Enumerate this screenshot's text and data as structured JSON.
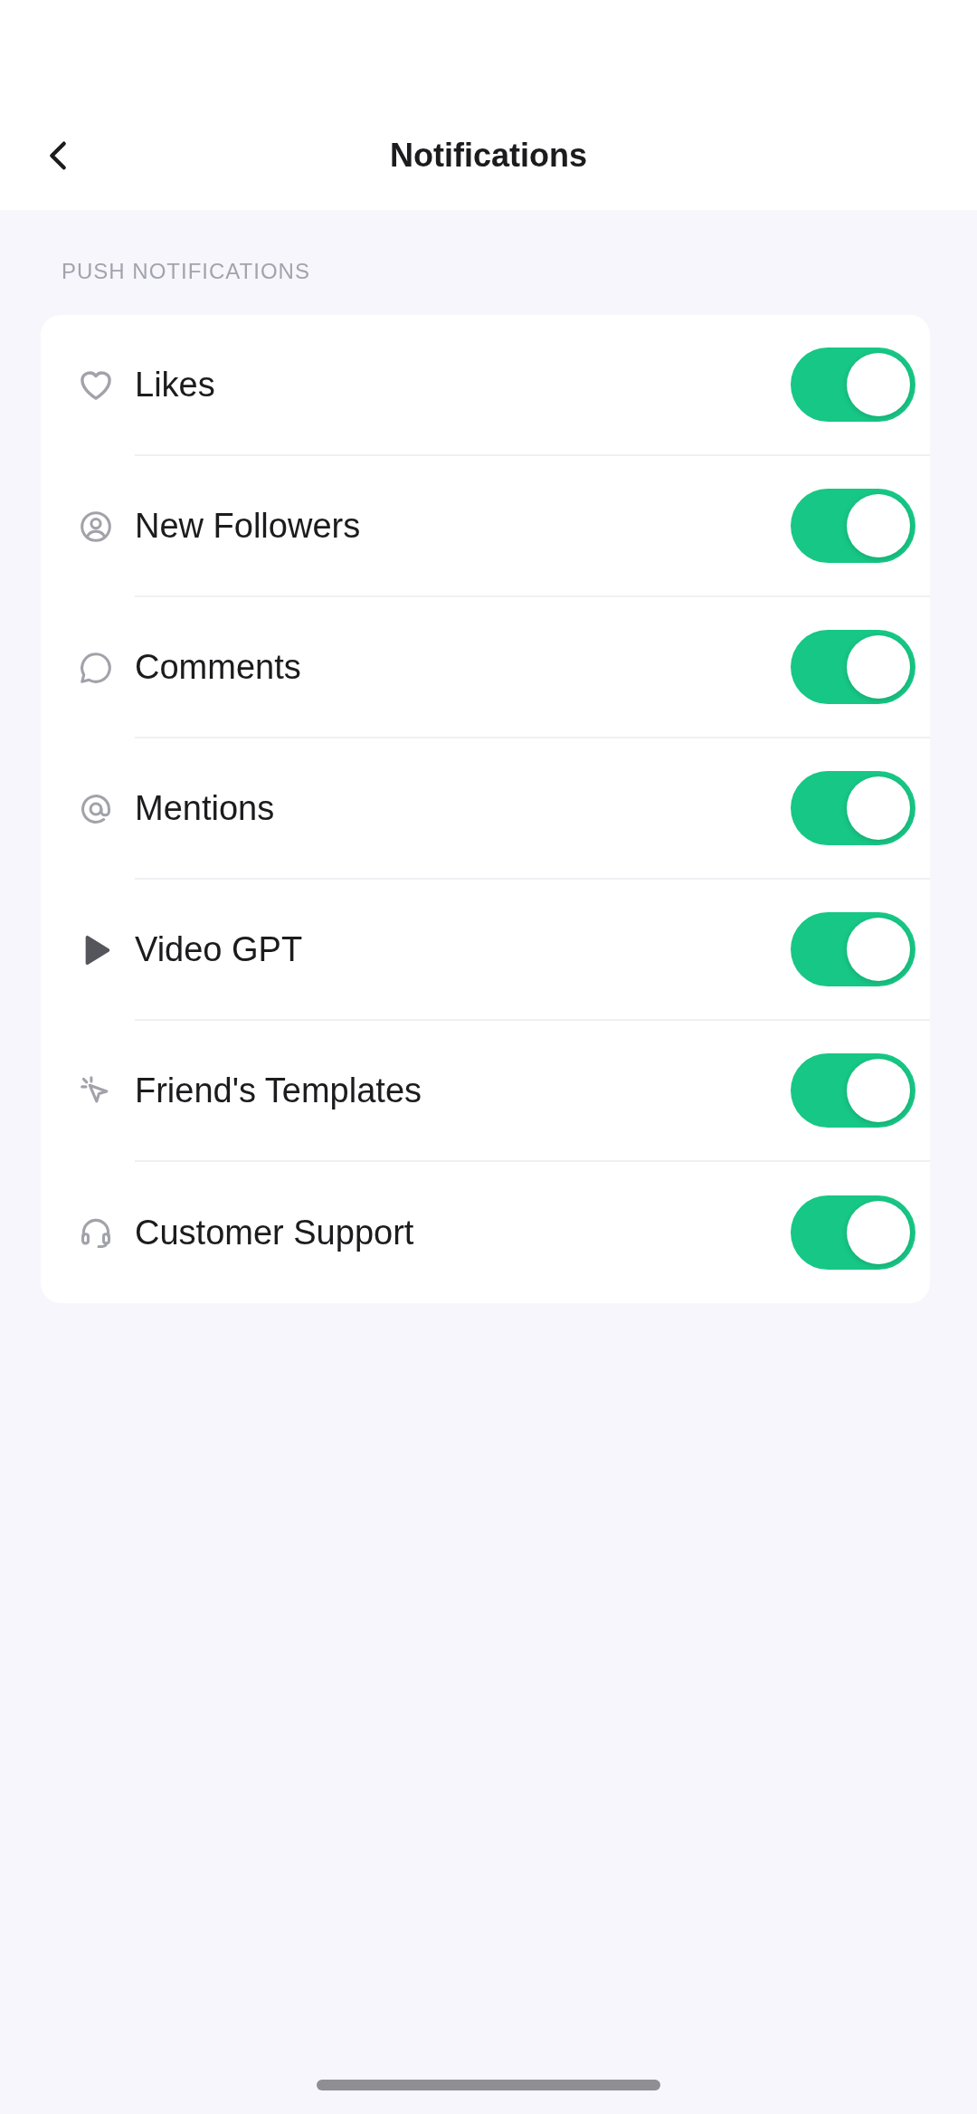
{
  "header": {
    "title": "Notifications"
  },
  "section": {
    "title": "PUSH NOTIFICATIONS"
  },
  "settings": [
    {
      "label": "Likes",
      "on": true
    },
    {
      "label": "New Followers",
      "on": true
    },
    {
      "label": "Comments",
      "on": true
    },
    {
      "label": "Mentions",
      "on": true
    },
    {
      "label": "Video GPT",
      "on": true
    },
    {
      "label": "Friend's Templates",
      "on": true
    },
    {
      "label": "Customer Support",
      "on": true
    }
  ]
}
